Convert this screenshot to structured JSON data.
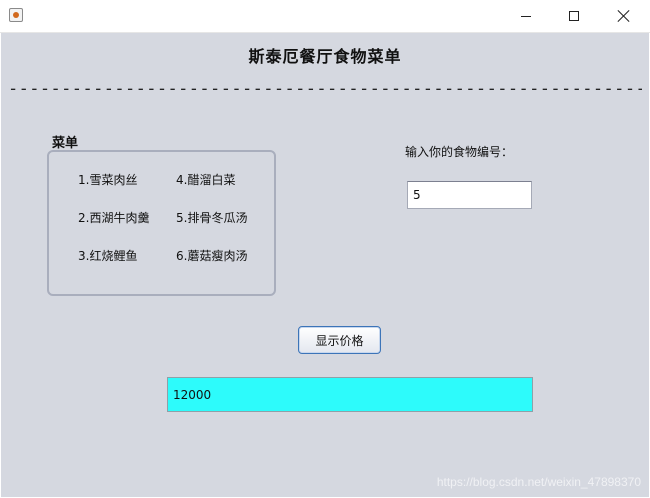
{
  "window": {
    "title": ""
  },
  "header": {
    "title": "斯泰厄餐厅食物菜单",
    "dashes": "--------------------------------------------------------------------------------"
  },
  "menu": {
    "label": "菜单",
    "items": [
      {
        "label": "1.雪菜肉丝"
      },
      {
        "label": "4.醋溜白菜"
      },
      {
        "label": "2.西湖牛肉羹"
      },
      {
        "label": "5.排骨冬瓜汤"
      },
      {
        "label": "3.红烧鲤鱼"
      },
      {
        "label": "6.蘑菇瘦肉汤"
      }
    ]
  },
  "form": {
    "input_label": "输入你的食物编号：",
    "input_value": "5",
    "button_label": "显示价格",
    "price_value": "12000"
  },
  "watermark": "https://blog.csdn.net/weixin_47898370",
  "colors": {
    "background": "#d5d8e0",
    "price_field": "#2dfbfb",
    "button_border": "#3c74b8"
  },
  "icons": {
    "app": "java-app-icon",
    "minimize": "minimize-icon",
    "maximize": "maximize-icon",
    "close": "close-icon"
  }
}
